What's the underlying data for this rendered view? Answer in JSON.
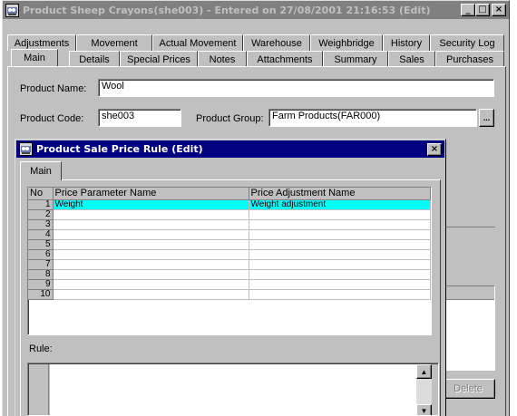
{
  "outer_window": {
    "title": "Product Sheep Crayons(she003) - Entered on 27/08/2001 21:16:53 (Edit)",
    "buttons": {
      "minimize": "_",
      "maximize": "□",
      "close": "×"
    },
    "tabs_row1": [
      "Adjustments",
      "Movement",
      "Actual Movement",
      "Warehouse",
      "Weighbridge",
      "History",
      "Security Log"
    ],
    "tabs_row2": [
      "Main",
      "Details",
      "Special Prices",
      "Notes",
      "Attachments",
      "Summary",
      "Sales",
      "Purchases"
    ],
    "selected_tab": "Main",
    "product_name_label": "Product Name:",
    "product_name_value": "Wool",
    "product_code_label": "Product Code:",
    "product_code_value": "she003",
    "product_group_label": "Product Group:",
    "product_group_value": "Farm Products(FAR000)",
    "ellipsis_button": "...",
    "delete_button": "Delete"
  },
  "dialog": {
    "title": "Product Sale Price Rule (Edit)",
    "close_button": "×",
    "tab": "Main",
    "grid": {
      "columns": [
        "No",
        "Price Parameter Name",
        "Price Adjustment Name"
      ],
      "rows": [
        {
          "no": "1",
          "param": "Weight",
          "adjust": "Weight adjustment"
        },
        {
          "no": "2",
          "param": "",
          "adjust": ""
        },
        {
          "no": "3",
          "param": "",
          "adjust": ""
        },
        {
          "no": "4",
          "param": "",
          "adjust": ""
        },
        {
          "no": "5",
          "param": "",
          "adjust": ""
        },
        {
          "no": "6",
          "param": "",
          "adjust": ""
        },
        {
          "no": "7",
          "param": "",
          "adjust": ""
        },
        {
          "no": "8",
          "param": "",
          "adjust": ""
        },
        {
          "no": "9",
          "param": "",
          "adjust": ""
        },
        {
          "no": "10",
          "param": "",
          "adjust": ""
        }
      ],
      "selected_row": 1
    },
    "rule_label": "Rule:",
    "rule_text": ""
  },
  "colors": {
    "window_face": "#c0c0c0",
    "active_title": "#000080",
    "inactive_title": "#808080",
    "selection": "#00ffff"
  },
  "icons": [
    "sheep-app-icon",
    "minimize-icon",
    "maximize-icon",
    "close-icon",
    "scroll-up-arrow-icon",
    "scroll-down-arrow-icon",
    "ellipsis-icon"
  ]
}
